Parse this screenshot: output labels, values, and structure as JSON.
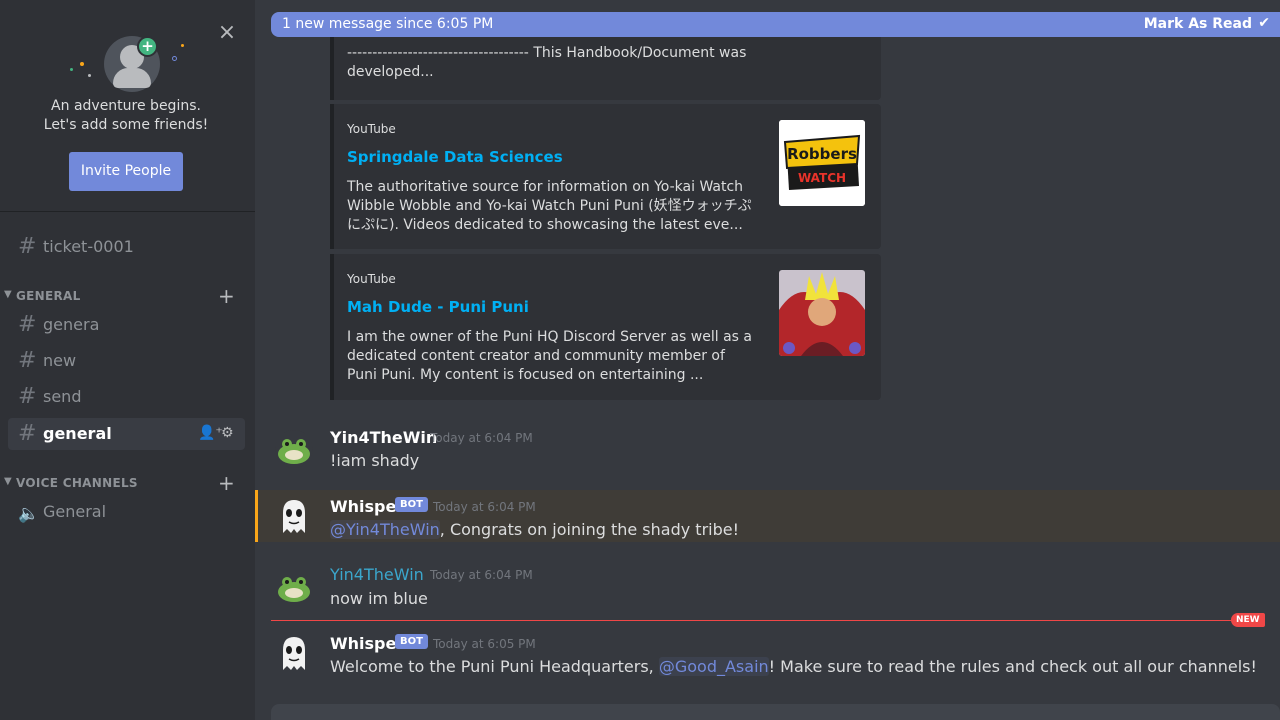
{
  "invite": {
    "line1": "An adventure begins.",
    "line2": "Let's add some friends!",
    "button": "Invite People",
    "close": "×"
  },
  "channels": {
    "ticket": "ticket-0001",
    "general_category": "GENERAL",
    "text": [
      "genera",
      "new",
      "send",
      "general"
    ],
    "voice_category": "VOICE CHANNELS",
    "voice": "General"
  },
  "new_bar": {
    "text": "1 new message since 6:05 PM",
    "mark": "Mark As Read"
  },
  "top_truncated": {
    "line1": "------------------------------------ This Handbook/Document was",
    "line2": "developed..."
  },
  "embeds": [
    {
      "provider": "YouTube",
      "title": "Springdale Data Sciences",
      "desc": "The authoritative source for information on Yo-kai Watch Wibble Wobble and Yo-kai Watch Puni Puni (妖怪ウォッチぷにぷに). Videos dedicated to showcasing the latest eve...",
      "thumb_text": "Robbers WATCH"
    },
    {
      "provider": "YouTube",
      "title": "Mah Dude - Puni Puni",
      "desc": "I am the owner of the Puni HQ Discord Server as well as a dedicated content creator and community member of Puni Puni. My content is focused on entertaining ..."
    }
  ],
  "messages": [
    {
      "user": "Yin4TheWin",
      "time": "Today at 6:04 PM",
      "text": "!iam shady"
    },
    {
      "user": "Whisper",
      "bot": "BOT",
      "time": "Today at 6:04 PM",
      "mention": "@Yin4TheWin",
      "text": ", Congrats on joining the shady tribe!"
    },
    {
      "user": "Yin4TheWin",
      "time": "Today at 6:04 PM",
      "text": "now im blue"
    },
    {
      "user": "Whisper",
      "bot": "BOT",
      "time": "Today at 6:05 PM",
      "pre": "Welcome to the Puni Puni Headquarters, ",
      "mention": "@Good_Asain",
      "post": "! Make sure to read the rules and check out all our channels!"
    }
  ],
  "new_label": "NEW",
  "colors": {
    "accent": "#7289da",
    "link": "#00b0f4",
    "danger": "#f04747",
    "highlight": "#faa61a",
    "blue_name": "#3ba6cc"
  }
}
